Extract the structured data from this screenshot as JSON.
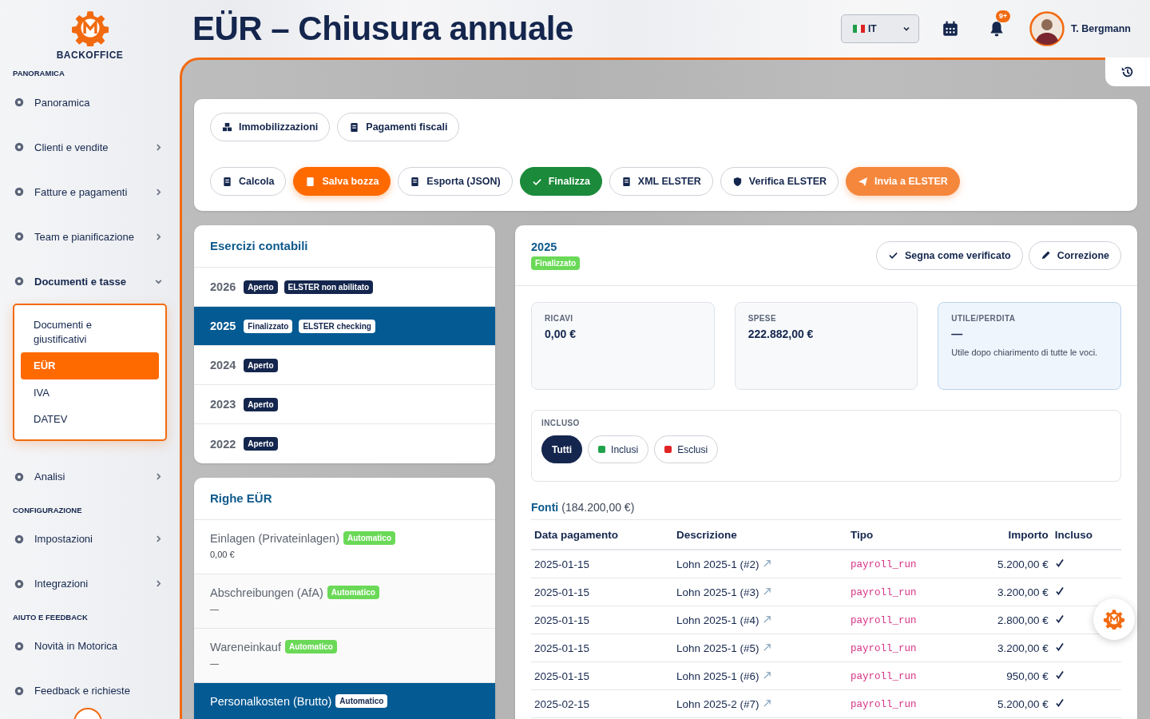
{
  "brand": "BACKOFFICE",
  "page_title": "EÜR – Chiusura annuale",
  "header": {
    "language": "IT",
    "notifications": "9+",
    "user": "T. Bergmann"
  },
  "sidebar": [
    {
      "kind": "heading",
      "label": "PANORAMICA"
    },
    {
      "kind": "item",
      "label": "Panoramica",
      "submenu": false
    },
    {
      "kind": "item",
      "label": "Clienti e vendite",
      "submenu": true
    },
    {
      "kind": "item",
      "label": "Fatture e pagamenti",
      "submenu": true
    },
    {
      "kind": "item",
      "label": "Team e pianificazione",
      "submenu": true
    },
    {
      "kind": "group",
      "label": "Documenti e tasse",
      "expanded": true,
      "children": [
        {
          "label": "Documenti e giustificativi",
          "selected": false
        },
        {
          "label": "EÜR",
          "selected": true
        },
        {
          "label": "IVA",
          "selected": false
        },
        {
          "label": "DATEV",
          "selected": false
        }
      ]
    },
    {
      "kind": "item",
      "label": "Analisi",
      "submenu": true
    },
    {
      "kind": "heading",
      "label": "CONFIGURAZIONE"
    },
    {
      "kind": "item",
      "label": "Impostazioni",
      "submenu": true
    },
    {
      "kind": "item",
      "label": "Integrazioni",
      "submenu": true
    },
    {
      "kind": "heading",
      "label": "AIUTO E FEEDBACK"
    },
    {
      "kind": "item",
      "label": "Novità in Motorica",
      "submenu": false
    },
    {
      "kind": "item",
      "label": "Feedback e richieste",
      "submenu": false
    }
  ],
  "toolbar": [
    [
      {
        "label": "Immobilizzazioni",
        "kind": "outline"
      },
      {
        "label": "Pagamenti fiscali",
        "kind": "outline"
      }
    ],
    [
      {
        "label": "Calcola",
        "kind": "outline"
      },
      {
        "label": "Salva bozza",
        "kind": "primary"
      },
      {
        "label": "Esporta (JSON)",
        "kind": "outline"
      },
      {
        "label": "Finalizza",
        "kind": "success"
      },
      {
        "label": "XML ELSTER",
        "kind": "outline"
      },
      {
        "label": "Verifica ELSTER",
        "kind": "outline"
      },
      {
        "label": "Invia a ELSTER",
        "kind": "accent"
      }
    ]
  ],
  "fiscal_years": {
    "title": "Esercizi contabili",
    "items": [
      {
        "year": "2026",
        "badges": [
          "Aperto",
          "ELSTER non abilitato"
        ],
        "selected": false
      },
      {
        "year": "2025",
        "badges": [
          "Finalizzato",
          "ELSTER checking"
        ],
        "selected": true
      },
      {
        "year": "2024",
        "badges": [
          "Aperto"
        ],
        "selected": false
      },
      {
        "year": "2023",
        "badges": [
          "Aperto"
        ],
        "selected": false
      },
      {
        "year": "2022",
        "badges": [
          "Aperto"
        ],
        "selected": false
      }
    ]
  },
  "eur_lines": {
    "title": "Righe EÜR",
    "items": [
      {
        "label": "Einlagen (Privateinlagen)",
        "badge": "Automatico",
        "amount": "0,00 €",
        "selected": false
      },
      {
        "label": "Abschreibungen (AfA)",
        "badge": "Automatico",
        "amount": "—",
        "selected": false
      },
      {
        "label": "Wareneinkauf",
        "badge": "Automatico",
        "amount": "—",
        "selected": false
      },
      {
        "label": "Personalkosten (Brutto)",
        "badge": "Automatico",
        "selected": true
      }
    ]
  },
  "detail": {
    "year": "2025",
    "status": "Finalizzato",
    "actions": [
      {
        "label": "Segna come verificato"
      },
      {
        "label": "Correzione"
      }
    ],
    "stats": [
      {
        "label": "RICAVI",
        "value": "0,00 €",
        "highlight": false
      },
      {
        "label": "SPESE",
        "value": "222.882,00 €",
        "highlight": false
      },
      {
        "label": "UTILE/PERDITA",
        "value": "—",
        "note": "Utile dopo chiarimento di tutte le voci.",
        "highlight": true
      }
    ],
    "filter": {
      "label": "INCLUSO",
      "chips": [
        {
          "label": "Tutti",
          "selected": true
        },
        {
          "label": "Inclusi",
          "color": "#1fa34a",
          "selected": false
        },
        {
          "label": "Esclusi",
          "color": "#e02424",
          "selected": false
        }
      ]
    },
    "sources": {
      "title": "Fonti",
      "total": "(184.200,00 €)",
      "columns": [
        "Data pagamento",
        "Descrizione",
        "Tipo",
        "Importo",
        "Incluso"
      ],
      "rows": [
        {
          "date": "2025-01-15",
          "description": "Lohn 2025-1 (#2)",
          "type": "payroll_run",
          "amount": "5.200,00 €",
          "included": true
        },
        {
          "date": "2025-01-15",
          "description": "Lohn 2025-1 (#3)",
          "type": "payroll_run",
          "amount": "3.200,00 €",
          "included": true
        },
        {
          "date": "2025-01-15",
          "description": "Lohn 2025-1 (#4)",
          "type": "payroll_run",
          "amount": "2.800,00 €",
          "included": true
        },
        {
          "date": "2025-01-15",
          "description": "Lohn 2025-1 (#5)",
          "type": "payroll_run",
          "amount": "3.200,00 €",
          "included": true
        },
        {
          "date": "2025-01-15",
          "description": "Lohn 2025-1 (#6)",
          "type": "payroll_run",
          "amount": "950,00 €",
          "included": true
        },
        {
          "date": "2025-02-15",
          "description": "Lohn 2025-2 (#7)",
          "type": "payroll_run",
          "amount": "5.200,00 €",
          "included": true
        }
      ]
    }
  }
}
